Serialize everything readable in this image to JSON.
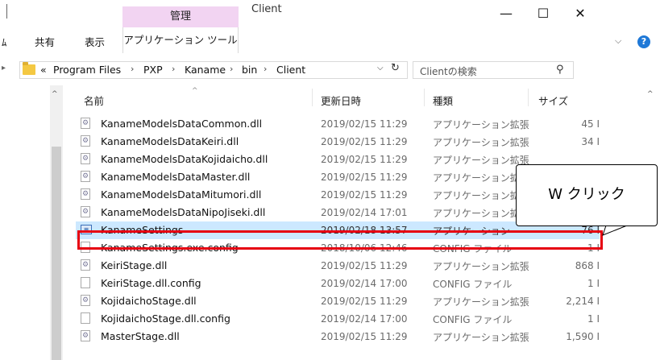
{
  "window": {
    "context_group": "管理",
    "title": "Client",
    "minimize": "—",
    "maximize": "☐",
    "close": "✕"
  },
  "ribbon": {
    "tab_partial": "ﾑ",
    "tab_share": "共有",
    "tab_view": "表示",
    "tab_app_tools": "アプリケーション ツール",
    "chevron": "⌵",
    "help": "?"
  },
  "address": {
    "nav_glyph": "▸",
    "overflow": "«",
    "crumbs": [
      "Program Files",
      "PXP",
      "Kaname",
      "bin",
      "Client"
    ],
    "separator": "›",
    "dropdown": "⌵",
    "refresh": "↻",
    "search_placeholder": "Clientの検索",
    "search_glyph": "⚲"
  },
  "columns": {
    "name": "名前",
    "date": "更新日時",
    "type": "種類",
    "size": "サイズ",
    "sort_glyph": "^",
    "scroll_up": "^"
  },
  "files": [
    {
      "name": "KanameModelsDataCommon.dll",
      "date": "2019/02/15 11:29",
      "type": "アプリケーション拡張",
      "size": "45 I",
      "icon": "dll"
    },
    {
      "name": "KanameModelsDataKeiri.dll",
      "date": "2019/02/15 11:29",
      "type": "アプリケーション拡張",
      "size": "34 I",
      "icon": "dll"
    },
    {
      "name": "KanameModelsDataKojidaicho.dll",
      "date": "2019/02/15 11:29",
      "type": "アプリケーション拡張",
      "size": "",
      "icon": "dll"
    },
    {
      "name": "KanameModelsDataMaster.dll",
      "date": "2019/02/15 11:29",
      "type": "アプリケーション拡張",
      "size": "",
      "icon": "dll"
    },
    {
      "name": "KanameModelsDataMitumori.dll",
      "date": "2019/02/15 11:29",
      "type": "アプリケーション拡張",
      "size": "",
      "icon": "dll"
    },
    {
      "name": "KanameModelsDataNipoJiseki.dll",
      "date": "2019/02/14 17:01",
      "type": "アプリケーション拡張",
      "size": "",
      "icon": "dll"
    },
    {
      "name": "KanameSettings",
      "date": "2019/02/18 13:57",
      "type": "アプリケーション",
      "size": "76 I",
      "icon": "app",
      "selected": true
    },
    {
      "name": "KanameSettings.exe.config",
      "date": "2018/10/06 12:46",
      "type": "CONFIG ファイル",
      "size": "1 I",
      "icon": "plain"
    },
    {
      "name": "KeiriStage.dll",
      "date": "2019/02/15 11:29",
      "type": "アプリケーション拡張",
      "size": "868 I",
      "icon": "dll"
    },
    {
      "name": "KeiriStage.dll.config",
      "date": "2019/02/14 17:00",
      "type": "CONFIG ファイル",
      "size": "1 I",
      "icon": "plain"
    },
    {
      "name": "KojidaichoStage.dll",
      "date": "2019/02/15 11:29",
      "type": "アプリケーション拡張",
      "size": "2,214 I",
      "icon": "dll"
    },
    {
      "name": "KojidaichoStage.dll.config",
      "date": "2019/02/14 17:00",
      "type": "CONFIG ファイル",
      "size": "1 I",
      "icon": "plain"
    },
    {
      "name": "MasterStage.dll",
      "date": "2019/02/15 11:29",
      "type": "アプリケーション拡張",
      "size": "1,590 I",
      "icon": "dll"
    }
  ],
  "callout": {
    "text": "W クリック"
  },
  "colors": {
    "selection": "#cce8ff",
    "highlight_border": "#e60012",
    "context_group": "#f2d4f2",
    "help": "#1e78d7"
  }
}
